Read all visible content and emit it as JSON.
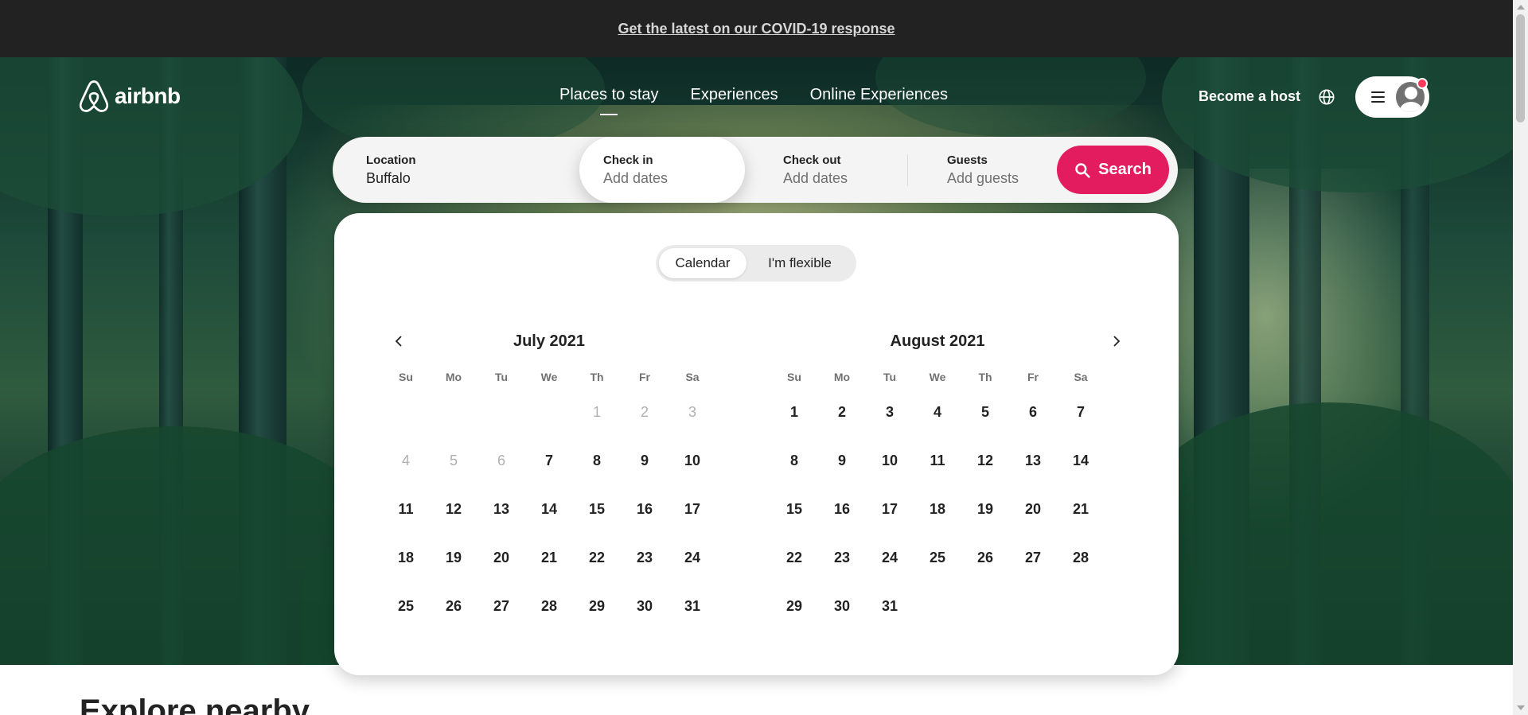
{
  "banner": {
    "link": "Get the latest on our COVID-19 response"
  },
  "header": {
    "logo_text": "airbnb",
    "nav": [
      "Places to stay",
      "Experiences",
      "Online Experiences"
    ],
    "active_nav": "Places to stay",
    "host_link": "Become a host"
  },
  "search": {
    "location_label": "Location",
    "location_value": "Buffalo",
    "checkin_label": "Check in",
    "checkin_placeholder": "Add dates",
    "checkout_label": "Check out",
    "checkout_placeholder": "Add dates",
    "guests_label": "Guests",
    "guests_placeholder": "Add guests",
    "button_label": "Search"
  },
  "calendar": {
    "toggle": [
      "Calendar",
      "I'm flexible"
    ],
    "active_toggle": "Calendar",
    "weekdays": [
      "Su",
      "Mo",
      "Tu",
      "We",
      "Th",
      "Fr",
      "Sa"
    ],
    "months": [
      {
        "title": "July 2021",
        "first_weekday": 4,
        "days": 31,
        "disabled_through": 6
      },
      {
        "title": "August 2021",
        "first_weekday": 0,
        "days": 31,
        "disabled_through": 0
      }
    ]
  },
  "section": {
    "title": "Explore nearby"
  },
  "colors": {
    "brand": "#e31c5f",
    "notification": "#ff385c",
    "banner": "#222222"
  }
}
